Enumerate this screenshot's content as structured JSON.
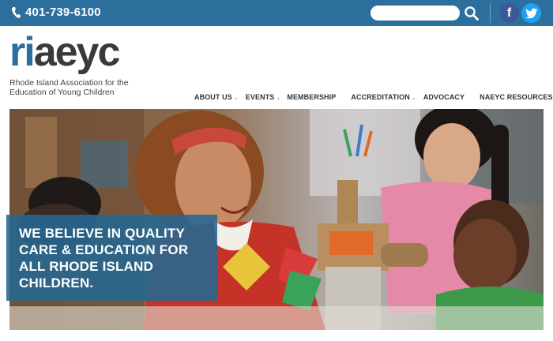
{
  "topbar": {
    "phone": "401-739-6100",
    "phone_icon": "phone-icon",
    "search_placeholder": "",
    "search_icon": "search-icon",
    "facebook_label": "f",
    "twitter_icon": "twitter-icon",
    "bg_color": "#2d6f9c"
  },
  "header": {
    "logo_ri": "ri",
    "logo_aeyc": "aeyc",
    "tagline_line1": "Rhode Island Association for the",
    "tagline_line2": "Education of Young Children"
  },
  "nav": {
    "items": [
      {
        "label": "ABOUT US",
        "has_dropdown": true
      },
      {
        "label": "EVENTS",
        "has_dropdown": true
      },
      {
        "label": "MEMBERSHIP",
        "has_dropdown": false
      },
      {
        "label": "ACCREDITATION",
        "has_dropdown": true
      },
      {
        "label": "ADVOCACY",
        "has_dropdown": false
      },
      {
        "label": "NAEYC RESOURCES",
        "has_dropdown": false
      }
    ]
  },
  "hero": {
    "headline": "WE BELIEVE IN QUALITY CARE & EDUCATION FOR ALL RHODE ISLAND CHILDREN.",
    "box_color": "#246892"
  }
}
